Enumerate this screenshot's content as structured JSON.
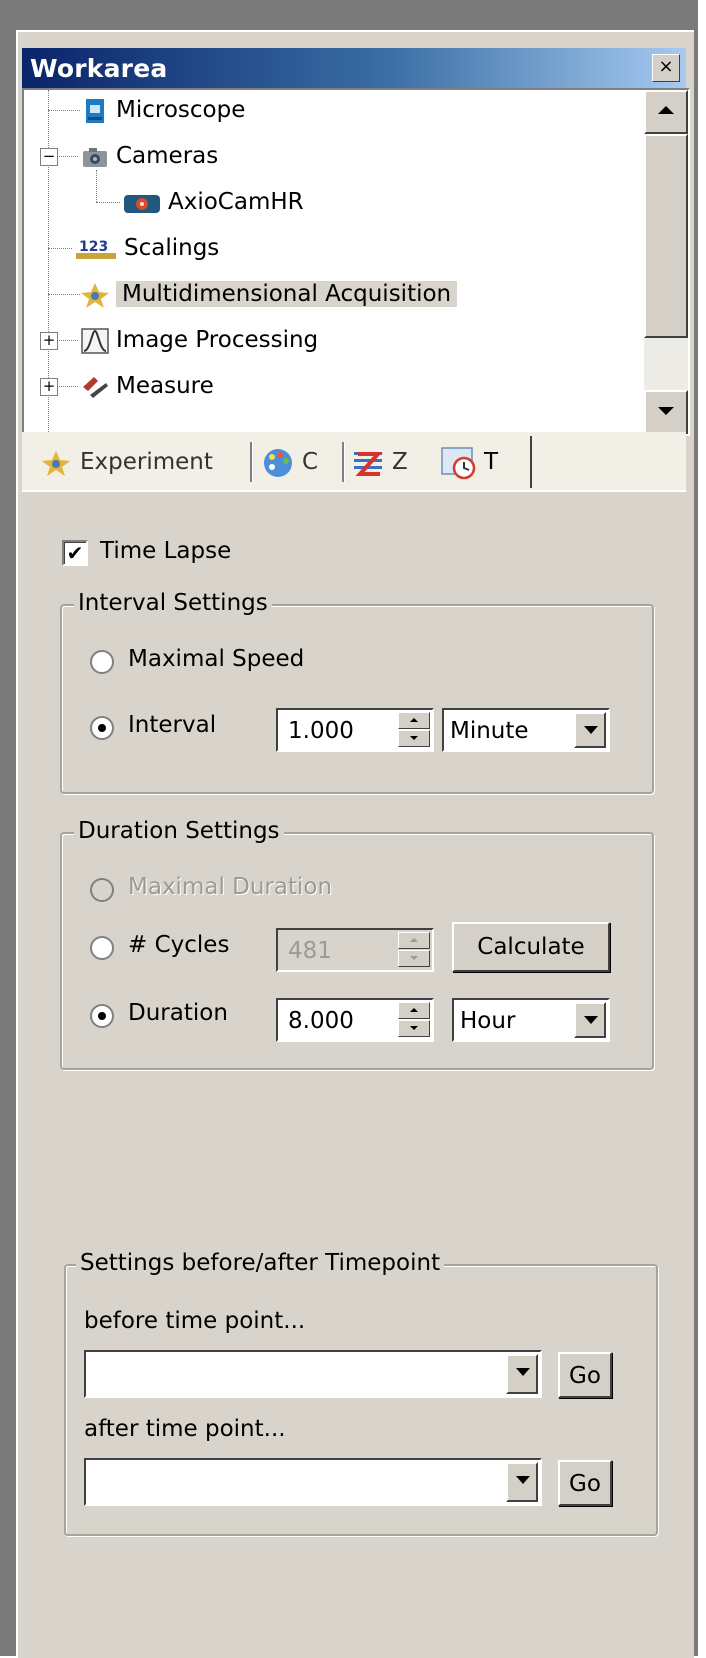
{
  "window": {
    "title": "Workarea",
    "close_glyph": "×"
  },
  "tree": {
    "items": [
      {
        "label": "Microscope",
        "icon": "microscope-icon"
      },
      {
        "label": "Cameras",
        "icon": "camera-icon",
        "expander": "−"
      },
      {
        "label": "AxioCamHR",
        "icon": "axiocam-icon"
      },
      {
        "label": "Scalings",
        "icon": "scalings-icon",
        "icon_text": "123"
      },
      {
        "label": "Multidimensional Acquisition",
        "icon": "acquisition-star-icon",
        "selected": true
      },
      {
        "label": "Image Processing",
        "icon": "image-processing-icon",
        "expander": "+"
      },
      {
        "label": "Measure",
        "icon": "measure-icon",
        "expander": "+"
      }
    ]
  },
  "tabs": [
    {
      "label": "Experiment",
      "icon": "experiment-star-icon"
    },
    {
      "label": "C",
      "icon": "palette-icon"
    },
    {
      "label": "Z",
      "icon": "z-stack-icon"
    },
    {
      "label": "T",
      "icon": "clock-icon",
      "active": true
    }
  ],
  "time_lapse": {
    "label": "Time Lapse",
    "checked": true,
    "check_glyph": "✔"
  },
  "interval_settings": {
    "title": "Interval Settings",
    "maximal_speed": {
      "label": "Maximal Speed",
      "selected": false
    },
    "interval": {
      "label": "Interval",
      "selected": true,
      "value": "1.000",
      "unit": "Minute"
    }
  },
  "duration_settings": {
    "title": "Duration Settings",
    "maximal_duration": {
      "label": "Maximal Duration",
      "selected": false,
      "enabled": false
    },
    "cycles": {
      "label": "# Cycles",
      "selected": false,
      "value": "481",
      "button": "Calculate"
    },
    "duration": {
      "label": "Duration",
      "selected": true,
      "value": "8.000",
      "unit": "Hour"
    }
  },
  "timepoint_settings": {
    "title": "Settings before/after Timepoint",
    "before_label": "before time point...",
    "before_value": "",
    "before_go": "Go",
    "after_label": "after time point...",
    "after_value": "",
    "after_go": "Go"
  },
  "colors": {
    "panel": "#d8d4cc",
    "title_start": "#0a246a",
    "title_end": "#a6caf0",
    "selection": "#d8d4cc"
  }
}
